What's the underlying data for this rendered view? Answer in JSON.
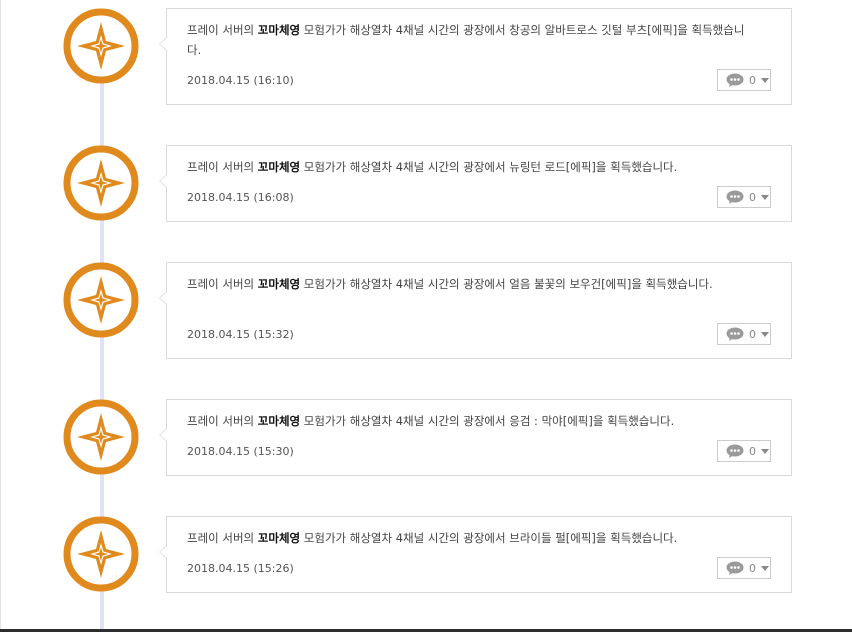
{
  "entries": [
    {
      "text_prefix": "프레이 서버의 ",
      "player": "꼬마체영",
      "text_suffix": " 모험가가 해상열차 4채널 시간의 광장에서 창공의 알바트로스 깃털 부츠[에픽]을 획득했습니다.",
      "date": "2018.04.15 (16:10)",
      "comments": "0"
    },
    {
      "text_prefix": "프레이 서버의 ",
      "player": "꼬마체영",
      "text_suffix": " 모험가가 해상열차 4채널 시간의 광장에서 뉴링턴 로드[에픽]을 획득했습니다.",
      "date": "2018.04.15 (16:08)",
      "comments": "0"
    },
    {
      "text_prefix": "프레이 서버의 ",
      "player": "꼬마체영",
      "text_suffix": " 모험가가 해상열차 4채널 시간의 광장에서 얼음 불꽃의 보우건[에픽]을 획득했습니다.",
      "date": "2018.04.15 (15:32)",
      "comments": "0"
    },
    {
      "text_prefix": "프레이 서버의 ",
      "player": "꼬마체영",
      "text_suffix": " 모험가가 해상열차 4채널 시간의 광장에서 응검 : 막야[에픽]을 획득했습니다.",
      "date": "2018.04.15 (15:30)",
      "comments": "0"
    },
    {
      "text_prefix": "프레이 서버의 ",
      "player": "꼬마체영",
      "text_suffix": " 모험가가 해상열차 4채널 시간의 광장에서 브라이들 펄[에픽]을 획득했습니다.",
      "date": "2018.04.15 (15:26)",
      "comments": "0"
    }
  ],
  "icons": {
    "emblem": "orange-compass-star-icon",
    "comment": "speech-bubble-icon",
    "dropdown": "caret-down-icon"
  },
  "colors": {
    "emblem": "#e08a1e",
    "timeline": "#dfe3fa",
    "card_border": "#d9d9d9"
  }
}
